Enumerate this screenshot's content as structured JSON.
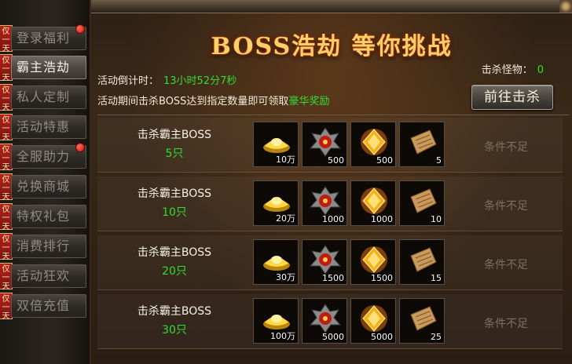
{
  "sidebar": {
    "tag_chars": [
      "仅",
      "一",
      "天"
    ],
    "items": [
      {
        "label": "登录福利",
        "badge": true,
        "active": false
      },
      {
        "label": "霸主浩劫",
        "badge": false,
        "active": true
      },
      {
        "label": "私人定制",
        "badge": false,
        "active": false
      },
      {
        "label": "活动特惠",
        "badge": false,
        "active": false
      },
      {
        "label": "全服助力",
        "badge": true,
        "active": false
      },
      {
        "label": "兑换商城",
        "badge": false,
        "active": false
      },
      {
        "label": "特权礼包",
        "badge": false,
        "active": false
      },
      {
        "label": "消费排行",
        "badge": false,
        "active": false
      },
      {
        "label": "活动狂欢",
        "badge": false,
        "active": false
      },
      {
        "label": "双倍充值",
        "badge": false,
        "active": false
      }
    ]
  },
  "header": {
    "title": "BOSS浩劫 等你挑战",
    "kill_label": "击杀怪物：",
    "kill_value": "0",
    "countdown_label": "活动倒计时：",
    "countdown_value": "13小时52分7秒",
    "desc_prefix": "活动期间击杀BOSS达到指定数量即可领取",
    "desc_highlight": "豪华奖励",
    "go_button": "前往击杀"
  },
  "rows": [
    {
      "title": "击杀霸主BOSS",
      "count": "5只",
      "status": "条件不足",
      "rewards": [
        {
          "icon": "gold-ingot",
          "qty": "10万"
        },
        {
          "icon": "demon-medal",
          "qty": "500"
        },
        {
          "icon": "gold-gem",
          "qty": "500"
        },
        {
          "icon": "scroll",
          "qty": "5"
        }
      ]
    },
    {
      "title": "击杀霸主BOSS",
      "count": "10只",
      "status": "条件不足",
      "rewards": [
        {
          "icon": "gold-ingot",
          "qty": "20万"
        },
        {
          "icon": "demon-medal",
          "qty": "1000"
        },
        {
          "icon": "gold-gem",
          "qty": "1000"
        },
        {
          "icon": "scroll",
          "qty": "10"
        }
      ]
    },
    {
      "title": "击杀霸主BOSS",
      "count": "20只",
      "status": "条件不足",
      "rewards": [
        {
          "icon": "gold-ingot",
          "qty": "30万"
        },
        {
          "icon": "demon-medal",
          "qty": "1500"
        },
        {
          "icon": "gold-gem",
          "qty": "1500"
        },
        {
          "icon": "scroll",
          "qty": "15"
        }
      ]
    },
    {
      "title": "击杀霸主BOSS",
      "count": "30只",
      "status": "条件不足",
      "rewards": [
        {
          "icon": "gold-ingot",
          "qty": "100万"
        },
        {
          "icon": "demon-medal",
          "qty": "5000"
        },
        {
          "icon": "gold-gem",
          "qty": "5000"
        },
        {
          "icon": "scroll",
          "qty": "25"
        }
      ]
    }
  ],
  "colors": {
    "highlight_green": "#33dd33",
    "title_gold": "#ffcf6a",
    "status_gray": "#7a7166"
  }
}
